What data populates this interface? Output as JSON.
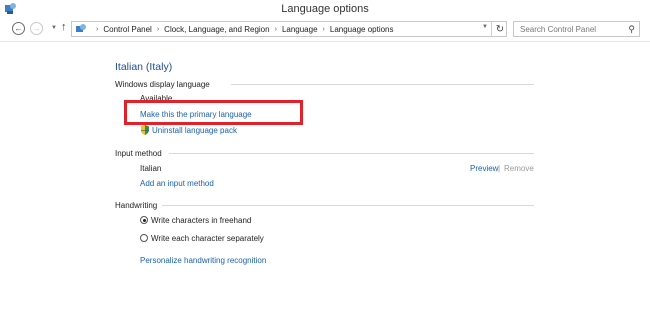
{
  "window": {
    "title": "Language options"
  },
  "address": {
    "breadcrumbs": [
      "Control Panel",
      "Clock, Language, and Region",
      "Language",
      "Language options"
    ],
    "search_placeholder": "Search Control Panel"
  },
  "language": {
    "name": "Italian (Italy)"
  },
  "display": {
    "title": "Windows display language",
    "status": "Available",
    "make_primary": "Make this the primary language",
    "uninstall": "Uninstall language pack"
  },
  "input": {
    "title": "Input method",
    "method": "Italian",
    "preview": "Preview",
    "separator": "|",
    "remove": "Remove",
    "add": "Add an input method"
  },
  "handwriting": {
    "title": "Handwriting",
    "opt1": "Write characters in freehand",
    "opt2": "Write each character separately",
    "opt1_checked": true,
    "personalize": "Personalize handwriting recognition"
  }
}
